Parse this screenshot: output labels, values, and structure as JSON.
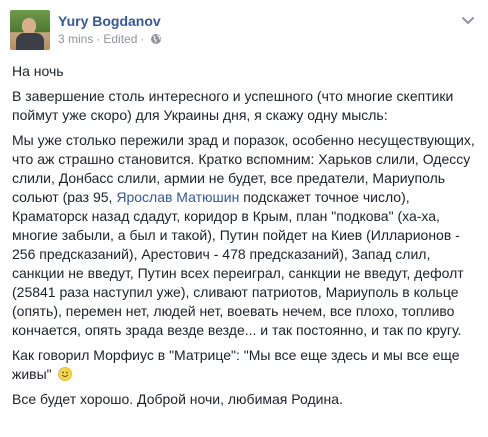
{
  "post": {
    "author": "Yury Bogdanov",
    "time": "3 mins",
    "edited": "Edited",
    "separator": "·",
    "privacy_icon": "globe-icon",
    "options_icon": "chevron-down-icon",
    "paragraphs": {
      "p1": "На ночь",
      "p2": "В завершение столь интересного и успешного (что многие скептики поймут уже скоро) для Украины дня, я скажу одну мысль:",
      "p3_part1": "Мы уже столько пережили зрад и поразок, особенно несуществующих, что аж страшно становится. Кратко вспомним: Харьков слили, Одессу слили, Донбасс слили, армии не будет, все предатели, Мариуполь сольют (раз 95, ",
      "p3_link": "Ярослав Матюшин",
      "p3_part2": " подскажет точное число), Краматорск назад сдадут, коридор в Крым, план \"подкова\" (ха-ха, многие забыли, а был и такой), Путин пойдет на Киев (Илларионов - 256 предсказаний), Арестович - 478 предсказаний), Запад слил, санкции не введут, Путин всех переиграл, санкции не введут, дефолт (25841 раза наступил уже), сливают патриотов, Мариуполь в кольце (опять), перемен нет, людей нет, воевать нечем, все плохо, топливо кончается, опять зрада везде везде... и так постоянно, и так по кругу.",
      "p4": "Как говорил Морфиус в \"Матрице\": \"Мы все еще здесь и мы все еще живы\"",
      "p4_emoji": "smile-emoji-icon",
      "p5": "Все будет хорошо. Доброй ночи, любимая Родина."
    },
    "colors": {
      "link": "#365899",
      "text": "#1d2129",
      "meta": "#90949c"
    }
  }
}
